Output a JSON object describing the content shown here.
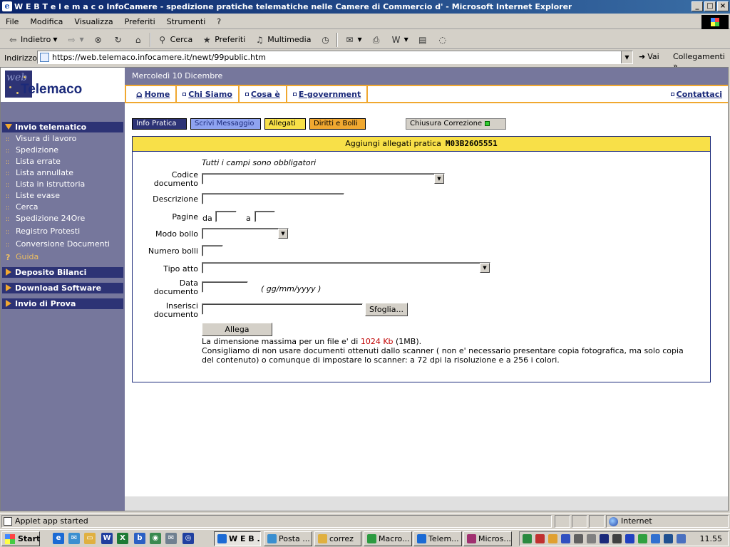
{
  "window": {
    "title": "W E B T e l e m a c o InfoCamere - spedizione pratiche telematiche nelle Camere di Commercio d' - Microsoft Internet Explorer"
  },
  "menu": [
    "File",
    "Modifica",
    "Visualizza",
    "Preferiti",
    "Strumenti",
    "?"
  ],
  "toolbar": {
    "back": "Indietro",
    "search": "Cerca",
    "favorites": "Preferiti",
    "multimedia": "Multimedia"
  },
  "address": {
    "label": "Indirizzo",
    "url": "https://web.telemaco.infocamere.it/newt/99public.htm",
    "go": "Vai",
    "links": "Collegamenti"
  },
  "page": {
    "logo_small": "web",
    "logo_text": "Telemaco",
    "date": "Mercoledì 10 Dicembre",
    "nav": [
      "Home",
      "Chi Siamo",
      "Cosa è",
      "E-government"
    ],
    "nav_contact": "Contattaci",
    "sidebar": {
      "section1": "Invio telematico",
      "items": [
        "Visura di lavoro",
        "Spedizione",
        "Lista errate",
        "Lista annullate",
        "Lista in istruttoria",
        "Liste evase",
        "Cerca",
        "Spedizione 24Ore",
        "Registro Protesti",
        "Conversione Documenti"
      ],
      "guide": "Guida",
      "guide_marker": "?",
      "section2": "Deposito Bilanci",
      "section3": "Download Software",
      "section4": "Invio di Prova"
    },
    "tabs": {
      "info": "Info Pratica",
      "message": "Scrivi Messaggio",
      "attachments": "Allegati",
      "fees": "Diritti e Bolli",
      "close": "Chiusura Correzione"
    },
    "colors": {
      "tab_info": "#2d3375",
      "tab_message": "#8fa3f0",
      "tab_attachments": "#f8e048",
      "tab_fees": "#f0a830",
      "panel_head": "#f8e048",
      "limit_red": "#c00000"
    },
    "form": {
      "heading": "Aggiungi allegati pratica",
      "code": "M03B26O5551",
      "required_note": "Tutti i campi sono obbligatori",
      "code_doc_label_1": "Codice",
      "code_doc_label_2": "documento",
      "description_label": "Descrizione",
      "pages_label": "Pagine",
      "pages_from": "da",
      "pages_to": "a",
      "stamp_mode_label": "Modo bollo",
      "stamp_count_label": "Numero bolli",
      "deed_type_label": "Tipo atto",
      "date_label_1": "Data",
      "date_label_2": "documento",
      "date_hint": "( gg/mm/yyyy )",
      "insert_label_1": "Inserisci",
      "insert_label_2": "documento",
      "browse_button": "Sfoglia...",
      "attach_button": "Allega",
      "limit_text_1": "La dimensione massima per un file e' di",
      "limit_value": "1024 Kb",
      "limit_text_2": "(1MB).",
      "advice_1": "Consigliamo di non usare documenti ottenuti dallo scanner ( non e' necessario presentare copia fotografica, ma solo copia",
      "advice_2": "del contenuto) o comunque di impostare lo scanner: a 72 dpi la risoluzione e a 256 i colori."
    }
  },
  "status": {
    "text": "Applet app started",
    "zone": "Internet"
  },
  "taskbar": {
    "start": "Start",
    "tasks": [
      "W E B ...",
      "Posta ...",
      "correz",
      "Macro...",
      "Telem...",
      "Micros..."
    ],
    "clock": "11.55"
  }
}
